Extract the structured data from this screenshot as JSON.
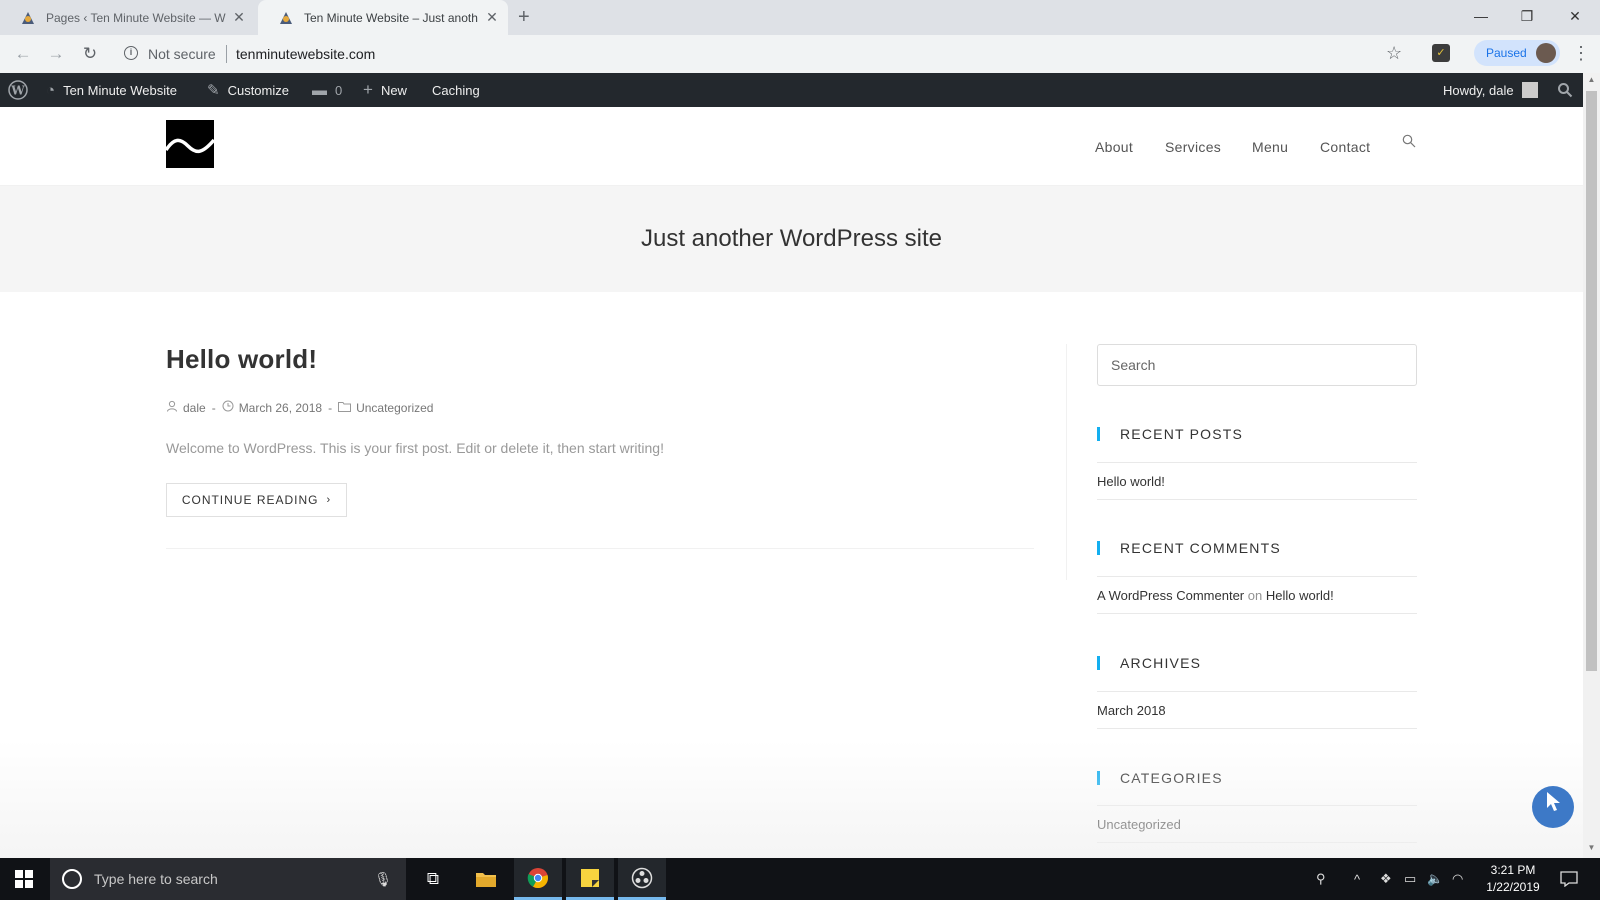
{
  "browser": {
    "tabs": [
      {
        "title": "Pages ‹ Ten Minute Website — W",
        "active": false
      },
      {
        "title": "Ten Minute Website – Just anoth",
        "active": true
      }
    ],
    "security": "Not secure",
    "url": "tenminutewebsite.com",
    "profile": "Paused"
  },
  "admin_bar": {
    "site_name": "Ten Minute Website",
    "customize": "Customize",
    "comments_count": "0",
    "new": "New",
    "caching": "Caching",
    "howdy": "Howdy, dale"
  },
  "site": {
    "nav": [
      "About",
      "Services",
      "Menu",
      "Contact"
    ],
    "page_title": "Just another WordPress site"
  },
  "post": {
    "title": "Hello world!",
    "author": "dale",
    "date": "March 26, 2018",
    "category": "Uncategorized",
    "excerpt": "Welcome to WordPress. This is your first post. Edit or delete it, then start writing!",
    "read_more": "CONTINUE READING"
  },
  "sidebar": {
    "search_placeholder": "Search",
    "recent_posts_title": "RECENT POSTS",
    "recent_posts": [
      "Hello world!"
    ],
    "recent_comments_title": "RECENT COMMENTS",
    "comment_author": "A WordPress Commenter",
    "comment_on": "on",
    "comment_post": "Hello world!",
    "archives_title": "ARCHIVES",
    "archives": [
      "March 2018"
    ],
    "categories_title": "CATEGORIES",
    "categories": [
      "Uncategorized"
    ]
  },
  "taskbar": {
    "search_placeholder": "Type here to search",
    "time": "3:21 PM",
    "date": "1/22/2019"
  },
  "colors": {
    "accent": "#13aff0",
    "admin_bar": "#23282d"
  }
}
